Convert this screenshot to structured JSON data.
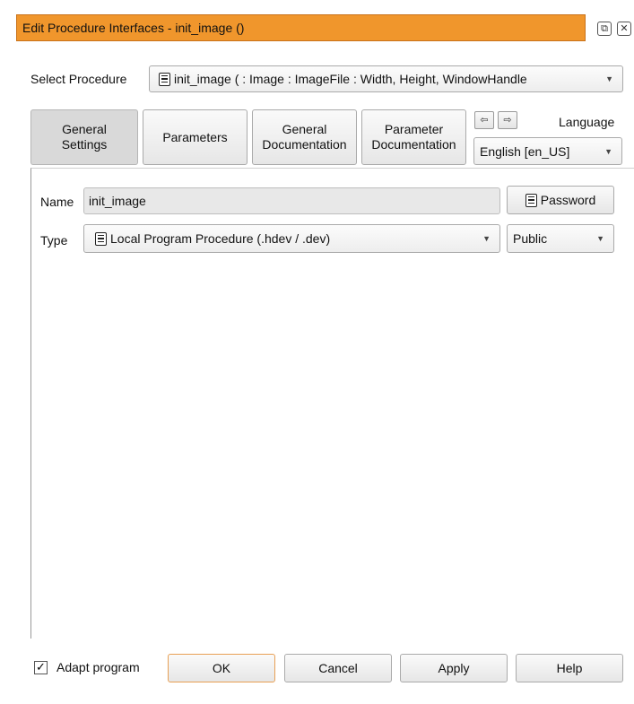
{
  "window": {
    "title": "Edit Procedure Interfaces - init_image ()",
    "restore_icon": "restore-icon",
    "close_icon": "close-icon"
  },
  "select_procedure": {
    "label": "Select Procedure",
    "value": "init_image ( : Image : ImageFile : Width, Height, WindowHandle"
  },
  "tabs": [
    {
      "label_line1": "General",
      "label_line2": "Settings",
      "active": true
    },
    {
      "label_line1": "Parameters",
      "label_line2": ""
    },
    {
      "label_line1": "General",
      "label_line2": "Documentation"
    },
    {
      "label_line1": "Parameter",
      "label_line2": "Documentation"
    }
  ],
  "nav": {
    "back_icon": "arrow-left-icon",
    "forward_icon": "arrow-right-icon"
  },
  "language": {
    "label": "Language",
    "value": "English [en_US]"
  },
  "general": {
    "name_label": "Name",
    "name_value": "init_image",
    "password_label": "Password",
    "type_label": "Type",
    "type_value": "Local Program Procedure (.hdev / .dev)",
    "visibility_value": "Public"
  },
  "footer": {
    "adapt_label": "Adapt program",
    "adapt_checked": true,
    "ok": "OK",
    "cancel": "Cancel",
    "apply": "Apply",
    "help": "Help"
  },
  "colors": {
    "title_bar": "#f0962c",
    "ok_border": "#e8a055"
  }
}
